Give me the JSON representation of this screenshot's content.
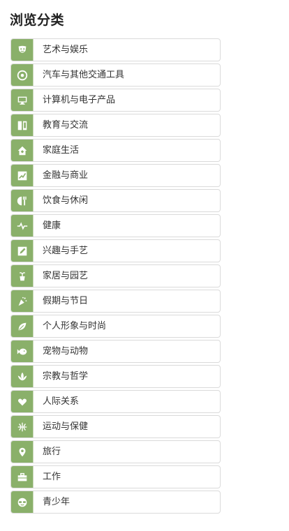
{
  "page": {
    "title": "浏览分类"
  },
  "categories": [
    {
      "label": "艺术与娱乐",
      "icon": "theater-masks-icon"
    },
    {
      "label": "汽车与其他交通工具",
      "icon": "steering-wheel-icon"
    },
    {
      "label": "计算机与电子产品",
      "icon": "monitor-icon"
    },
    {
      "label": "教育与交流",
      "icon": "book-icon"
    },
    {
      "label": "家庭生活",
      "icon": "home-icon"
    },
    {
      "label": "金融与商业",
      "icon": "chart-icon"
    },
    {
      "label": "饮食与休闲",
      "icon": "fork-knife-icon"
    },
    {
      "label": "健康",
      "icon": "heartbeat-icon"
    },
    {
      "label": "兴趣与手艺",
      "icon": "pencil-icon"
    },
    {
      "label": "家居与园艺",
      "icon": "potted-plant-icon"
    },
    {
      "label": "假期与节日",
      "icon": "party-icon"
    },
    {
      "label": "个人形象与时尚",
      "icon": "leaf-icon"
    },
    {
      "label": "宠物与动物",
      "icon": "fish-icon"
    },
    {
      "label": "宗教与哲学",
      "icon": "lotus-icon"
    },
    {
      "label": "人际关系",
      "icon": "heart-icon"
    },
    {
      "label": "运动与保健",
      "icon": "basketball-icon"
    },
    {
      "label": "旅行",
      "icon": "map-pin-icon"
    },
    {
      "label": "工作",
      "icon": "briefcase-icon"
    },
    {
      "label": "青少年",
      "icon": "sunglasses-face-icon"
    }
  ],
  "colors": {
    "icon_background": "#8ab06a",
    "border": "#dadada",
    "text": "#333333",
    "title": "#222222"
  }
}
